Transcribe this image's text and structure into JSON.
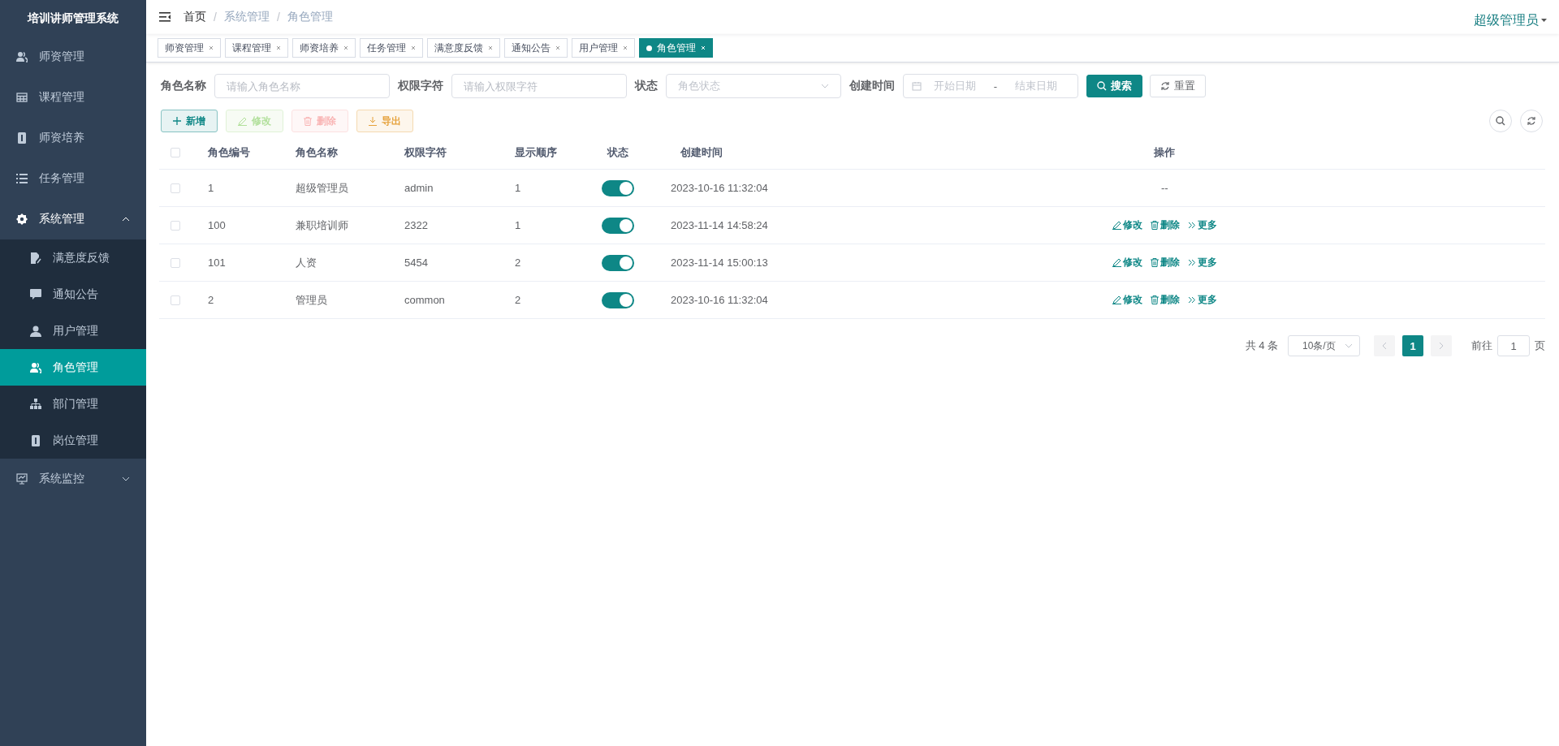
{
  "sidebar": {
    "title": "培训讲师管理系统",
    "items": [
      {
        "label": "师资管理",
        "selected": false
      },
      {
        "label": "课程管理",
        "selected": false
      },
      {
        "label": "师资培养",
        "selected": false
      },
      {
        "label": "任务管理",
        "selected": false
      },
      {
        "label": "系统管理",
        "selected": false,
        "expanded": true,
        "children": [
          {
            "label": "满意度反馈",
            "selected": false
          },
          {
            "label": "通知公告",
            "selected": false
          },
          {
            "label": "用户管理",
            "selected": false
          },
          {
            "label": "角色管理",
            "selected": true
          },
          {
            "label": "部门管理",
            "selected": false
          },
          {
            "label": "岗位管理",
            "selected": false
          }
        ]
      },
      {
        "label": "系统监控",
        "selected": false,
        "expanded": false
      }
    ]
  },
  "header": {
    "breadcrumb": [
      {
        "label": "首页",
        "link": true
      },
      {
        "label": "系统管理",
        "link": false
      },
      {
        "label": "角色管理",
        "link": false
      }
    ],
    "separator": "/",
    "user": "超级管理员"
  },
  "tags": [
    {
      "label": "师资管理",
      "selected": false
    },
    {
      "label": "课程管理",
      "selected": false
    },
    {
      "label": "师资培养",
      "selected": false
    },
    {
      "label": "任务管理",
      "selected": false
    },
    {
      "label": "满意度反馈",
      "selected": false
    },
    {
      "label": "通知公告",
      "selected": false
    },
    {
      "label": "用户管理",
      "selected": false
    },
    {
      "label": "角色管理",
      "selected": true
    }
  ],
  "filters": [
    {
      "kind": "input",
      "label": "角色名称",
      "placeholder": "请输入角色名称"
    },
    {
      "kind": "input",
      "label": "权限字符",
      "placeholder": "请输入权限字符"
    },
    {
      "kind": "select",
      "label": "状态",
      "placeholder": "角色状态"
    },
    {
      "kind": "daterange",
      "label": "创建时间",
      "start_placeholder": "开始日期",
      "separator": "-",
      "end_placeholder": "结束日期"
    }
  ],
  "search_button": "搜索",
  "reset_button": "重置",
  "toolbar": [
    {
      "kind": "primary",
      "label": "新增",
      "disabled": false
    },
    {
      "kind": "success",
      "label": "修改",
      "disabled": true
    },
    {
      "kind": "danger",
      "label": "删除",
      "disabled": true
    },
    {
      "kind": "warning",
      "label": "导出",
      "disabled": false
    }
  ],
  "table": {
    "header_checked": false,
    "columns": [
      "角色编号",
      "角色名称",
      "权限字符",
      "显示顺序",
      "状态",
      "创建时间",
      "操作"
    ],
    "rows": [
      {
        "checked": false,
        "id": "1",
        "name": "超级管理员",
        "key": "admin",
        "sort": "1",
        "enabled": true,
        "created": "2023-10-16 11:32:04",
        "placeholder": "--"
      },
      {
        "checked": false,
        "id": "100",
        "name": "兼职培训师",
        "key": "2322",
        "sort": "1",
        "enabled": true,
        "created": "2023-11-14 14:58:24",
        "actions": [
          "修改",
          "删除",
          "更多"
        ]
      },
      {
        "checked": false,
        "id": "101",
        "name": "人资",
        "key": "5454",
        "sort": "2",
        "enabled": true,
        "created": "2023-11-14 15:00:13",
        "actions": [
          "修改",
          "删除",
          "更多"
        ]
      },
      {
        "checked": false,
        "id": "2",
        "name": "管理员",
        "key": "common",
        "sort": "2",
        "enabled": true,
        "created": "2023-10-16 11:32:04",
        "actions": [
          "修改",
          "删除",
          "更多"
        ]
      }
    ]
  },
  "pagination": {
    "total": "共 4 条",
    "page_size": "10条/页",
    "pages": [
      {
        "label": "1",
        "selected": true
      }
    ],
    "goto_label": "前往",
    "goto_value": "1",
    "goto_suffix": "页"
  }
}
